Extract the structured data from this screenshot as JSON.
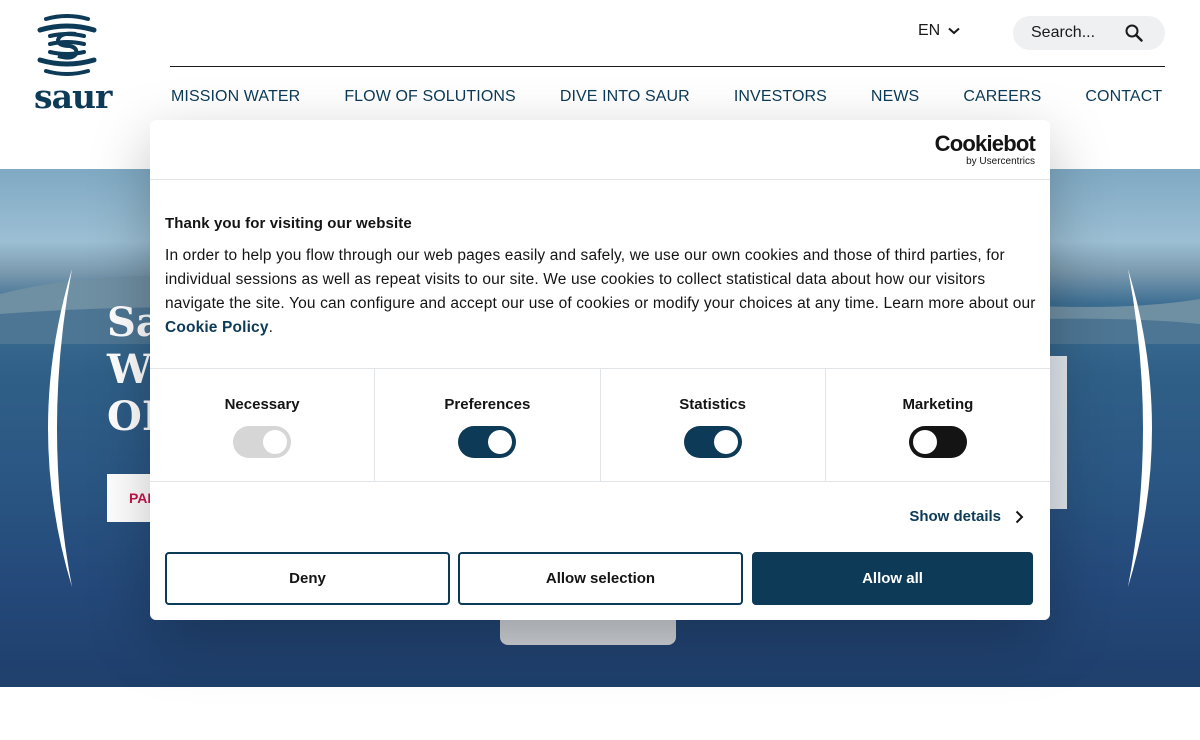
{
  "header": {
    "logo_text": "saur",
    "language": "EN",
    "search_placeholder": "Search...",
    "nav": [
      "MISSION WATER",
      "FLOW OF SOLUTIONS",
      "DIVE INTO SAUR",
      "INVESTORS",
      "NEWS",
      "CAREERS",
      "CONTACT"
    ]
  },
  "hero": {
    "title_lines": [
      "Sa",
      "Wa",
      "OE"
    ],
    "button_label": "PAI"
  },
  "cookie_dialog": {
    "brand": "Cookiebot",
    "brand_sub": "by Usercentrics",
    "title": "Thank you for visiting our website",
    "body": "In order to help you flow through our web pages easily and safely, we use our own cookies and those of third parties, for individual sessions as well as repeat visits to our site. We use cookies to collect statistical data about how our visitors navigate the site. You can configure and accept our use of cookies or modify your choices at any time. Learn more about our ",
    "policy_link": "Cookie Policy",
    "body_end": ".",
    "categories": [
      {
        "label": "Necessary",
        "state": "disabled-on"
      },
      {
        "label": "Preferences",
        "state": "on"
      },
      {
        "label": "Statistics",
        "state": "on"
      },
      {
        "label": "Marketing",
        "state": "off"
      }
    ],
    "show_details": "Show details",
    "buttons": {
      "deny": "Deny",
      "allow_selection": "Allow selection",
      "allow_all": "Allow all"
    }
  },
  "colors": {
    "brand_navy": "#0c3a57",
    "accent_red": "#c8154c"
  },
  "icons": [
    "chevron-down-icon",
    "search-icon",
    "chevron-right-icon"
  ]
}
